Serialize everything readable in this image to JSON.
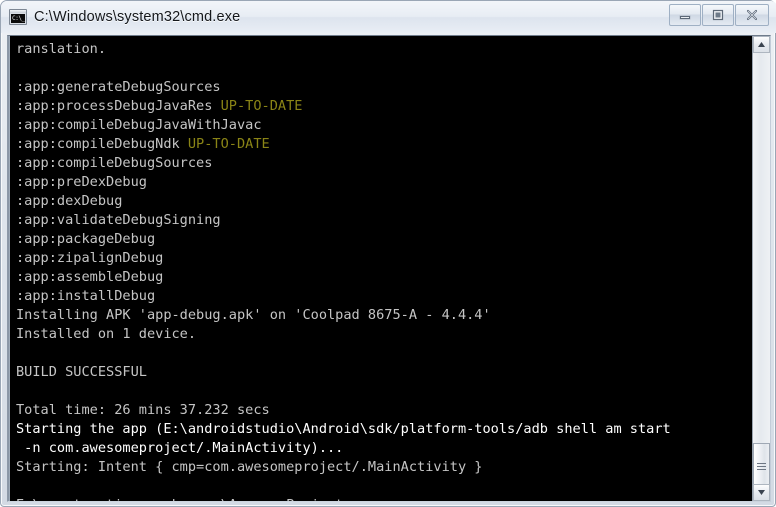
{
  "window": {
    "title": "C:\\Windows\\system32\\cmd.exe",
    "icon_name": "cmd-icon",
    "icon_glyph": "C:\\_",
    "buttons": {
      "minimize_label": "Minimize",
      "maximize_label": "Maximize",
      "close_label": "Close"
    },
    "colors": {
      "console_background": "#000000",
      "console_foreground": "#c5c5c5",
      "console_bright": "#ffffff",
      "up_to_date": "#8a8416",
      "frame": "#dfe5ec"
    }
  },
  "console": {
    "lines": [
      {
        "text": "ranslation.",
        "style": "dim"
      },
      {
        "text": "",
        "style": "dim"
      },
      {
        "text": ":app:generateDebugSources",
        "style": "dim"
      },
      {
        "text": ":app:processDebugJavaRes ",
        "style": "dim",
        "suffix": "UP-TO-DATE",
        "suffix_style": "uptodate"
      },
      {
        "text": ":app:compileDebugJavaWithJavac",
        "style": "dim"
      },
      {
        "text": ":app:compileDebugNdk ",
        "style": "dim",
        "suffix": "UP-TO-DATE",
        "suffix_style": "uptodate"
      },
      {
        "text": ":app:compileDebugSources",
        "style": "dim"
      },
      {
        "text": ":app:preDexDebug",
        "style": "dim"
      },
      {
        "text": ":app:dexDebug",
        "style": "dim"
      },
      {
        "text": ":app:validateDebugSigning",
        "style": "dim"
      },
      {
        "text": ":app:packageDebug",
        "style": "dim"
      },
      {
        "text": ":app:zipalignDebug",
        "style": "dim"
      },
      {
        "text": ":app:assembleDebug",
        "style": "dim"
      },
      {
        "text": ":app:installDebug",
        "style": "dim"
      },
      {
        "text": "Installing APK 'app-debug.apk' on 'Coolpad 8675-A - 4.4.4'",
        "style": "dim"
      },
      {
        "text": "Installed on 1 device.",
        "style": "dim"
      },
      {
        "text": "",
        "style": "dim"
      },
      {
        "text": "BUILD SUCCESSFUL",
        "style": "dim"
      },
      {
        "text": "",
        "style": "dim"
      },
      {
        "text": "Total time: 26 mins 37.232 secs",
        "style": "dim"
      },
      {
        "text": "Starting the app (E:\\androidstudio\\Android\\sdk/platform-tools/adb shell am start",
        "style": "bright"
      },
      {
        "text": " -n com.awesomeproject/.MainActivity)...",
        "style": "bright"
      },
      {
        "text": "Starting: Intent { cmp=com.awesomeproject/.MainActivity }",
        "style": "dim"
      },
      {
        "text": "",
        "style": "dim"
      },
      {
        "text": "E:\\react_native_workspace\\AwesomeProject>",
        "style": "dim"
      }
    ]
  },
  "scrollbar": {
    "up_arrow_name": "scroll-up-arrow",
    "down_arrow_name": "scroll-down-arrow",
    "thumb_name": "scrollbar-thumb",
    "position_percent": 92
  }
}
